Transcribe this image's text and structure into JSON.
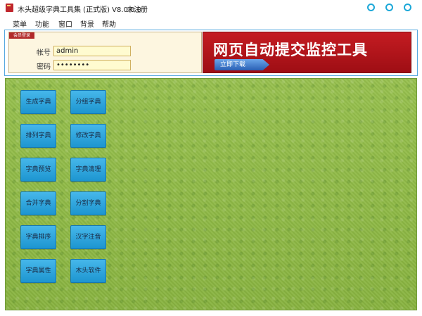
{
  "window": {
    "title": "木头超级字典工具集 (正式版) V8.0.0.0",
    "status": "未注册"
  },
  "menu": [
    "菜单",
    "功能",
    "窗口",
    "背景",
    "帮助"
  ],
  "login": {
    "tag": "会员登录",
    "account_label": "帐号",
    "account_value": "admin",
    "password_label": "密码",
    "password_value": "••••••••"
  },
  "ad": {
    "text": "网页自动提交监控工具",
    "button": "立即下载"
  },
  "tools": {
    "left": [
      "生成字典",
      "排列字典",
      "字典预览",
      "合并字典",
      "字典排序",
      "字典属性"
    ],
    "right": [
      "分组字典",
      "修改字典",
      "字典清理",
      "分割字典",
      "汉字注音",
      "木头软件"
    ]
  },
  "colors": {
    "accent": "#1ca8d8",
    "button": "#2aa6de",
    "grass": "#8fb848",
    "banner": "#b51820"
  }
}
